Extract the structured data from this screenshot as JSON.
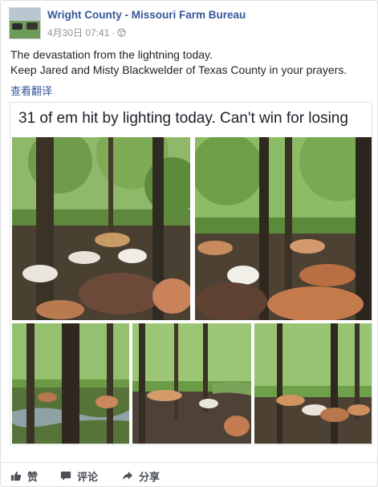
{
  "page": {
    "name": "Wright County - Missouri Farm Bureau",
    "date": "4月30日 07:41",
    "separator": "·",
    "privacy_icon": "globe-icon"
  },
  "post": {
    "lines": [
      "The devastation from the lightning today.",
      "Keep Jared and Misty Blackwelder of Texas County in your prayers."
    ],
    "translate_link": "查看翻译"
  },
  "shared_image": {
    "caption": "31 of em hit by lighting today. Can't win for losing",
    "photo_count": 5
  },
  "actions": {
    "like_label": "赞",
    "like_icon": "thumbs-up-icon",
    "comment_label": "评论",
    "comment_icon": "comment-icon",
    "share_label": "分享",
    "share_icon": "share-arrow-icon"
  },
  "colors": {
    "link": "#365899",
    "text": "#1d2129",
    "meta": "#90949c",
    "action_text": "#4b4f56"
  }
}
